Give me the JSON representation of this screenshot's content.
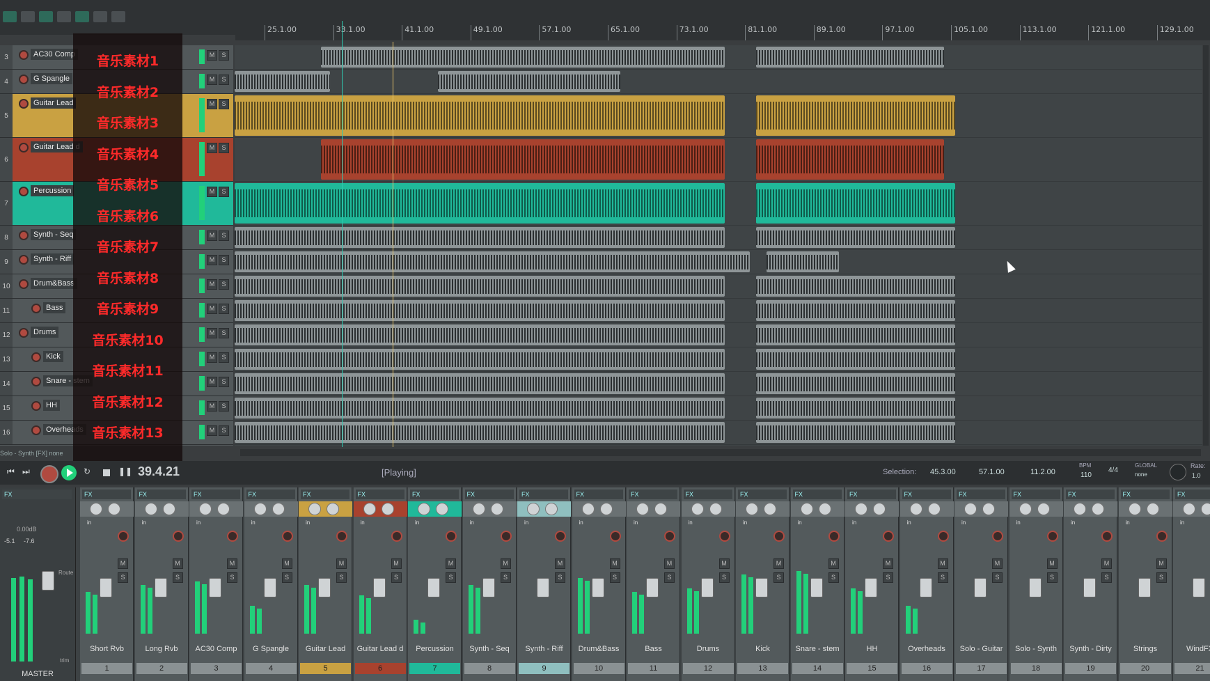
{
  "colors": {
    "accent_green": "#22d07a",
    "guitar_lead": "#c9a142",
    "guitar_lead_d": "#a8422e",
    "percussion": "#20b99a",
    "rec_red": "#b04a40",
    "overlay_text": "#ff2a2a",
    "grey_item": "#8e9597"
  },
  "ruler": {
    "ticks": [
      "25.1.00",
      "33.1.00",
      "41.1.00",
      "49.1.00",
      "57.1.00",
      "65.1.00",
      "73.1.00",
      "81.1.00",
      "89.1.00",
      "97.1.00",
      "105.1.00",
      "113.1.00",
      "121.1.00",
      "129.1.00"
    ]
  },
  "tracks": [
    {
      "num": "3",
      "name": "AC30 Comp",
      "overlay": "音乐素材1"
    },
    {
      "num": "4",
      "name": "G Spangle",
      "overlay": "音乐素材2"
    },
    {
      "num": "5",
      "name": "Guitar Lead",
      "overlay": "音乐素材3"
    },
    {
      "num": "6",
      "name": "Guitar Lead d",
      "overlay": "音乐素材4"
    },
    {
      "num": "7",
      "name": "Percussion",
      "overlay": "音乐素材5"
    },
    {
      "num": "8",
      "name": "Synth - Seq",
      "overlay": "音乐素材6"
    },
    {
      "num": "9",
      "name": "Synth - Riff",
      "overlay": "音乐素材7"
    },
    {
      "num": "10",
      "name": "Drum&Bass",
      "overlay": "音乐素材8"
    },
    {
      "num": "11",
      "name": "Bass",
      "overlay": "音乐素材9"
    },
    {
      "num": "12",
      "name": "Drums",
      "overlay": "音乐素材10"
    },
    {
      "num": "13",
      "name": "Kick",
      "overlay": "音乐素材11"
    },
    {
      "num": "14",
      "name": "Snare - stem",
      "overlay": "音乐素材12"
    },
    {
      "num": "15",
      "name": "HH",
      "overlay": "音乐素材13"
    },
    {
      "num": "16",
      "name": "Overheads",
      "overlay": ""
    }
  ],
  "track_buttons": {
    "mute": "M",
    "solo": "S"
  },
  "status_line": "Solo - Synth [FX] none",
  "transport": {
    "position": "39.4.21",
    "state": "[Playing]",
    "selection_label": "Selection:",
    "sel_start": "45.3.00",
    "sel_end": "57.1.00",
    "sel_length": "11.2.00",
    "bpm_label": "BPM",
    "bpm": "110",
    "time_sig": "4/4",
    "global_label": "GLOBAL",
    "global_value": "none",
    "rate_label": "Rate:",
    "rate": "1.0"
  },
  "master": {
    "label": "MASTER",
    "db1": "-5.1",
    "db2": "-7.6",
    "vol": "0.00dB",
    "route": "Route",
    "trim": "trim"
  },
  "fx_label": "FX",
  "strip_in": "in",
  "strips": [
    {
      "name": "Short Rvb",
      "num": "1"
    },
    {
      "name": "Long Rvb",
      "num": "2"
    },
    {
      "name": "AC30 Comp",
      "num": "3"
    },
    {
      "name": "G Spangle",
      "num": "4"
    },
    {
      "name": "Guitar Lead",
      "num": "5"
    },
    {
      "name": "Guitar Lead d",
      "num": "6"
    },
    {
      "name": "Percussion",
      "num": "7"
    },
    {
      "name": "Synth - Seq",
      "num": "8"
    },
    {
      "name": "Synth - Riff",
      "num": "9"
    },
    {
      "name": "Drum&Bass",
      "num": "10"
    },
    {
      "name": "Bass",
      "num": "11"
    },
    {
      "name": "Drums",
      "num": "12"
    },
    {
      "name": "Kick",
      "num": "13"
    },
    {
      "name": "Snare - stem",
      "num": "14"
    },
    {
      "name": "HH",
      "num": "15"
    },
    {
      "name": "Overheads",
      "num": "16"
    },
    {
      "name": "Solo - Guitar",
      "num": "17"
    },
    {
      "name": "Solo - Synth",
      "num": "18"
    },
    {
      "name": "Synth - Dirty",
      "num": "19"
    },
    {
      "name": "Strings",
      "num": "20"
    },
    {
      "name": "WindFX",
      "num": "21"
    }
  ]
}
